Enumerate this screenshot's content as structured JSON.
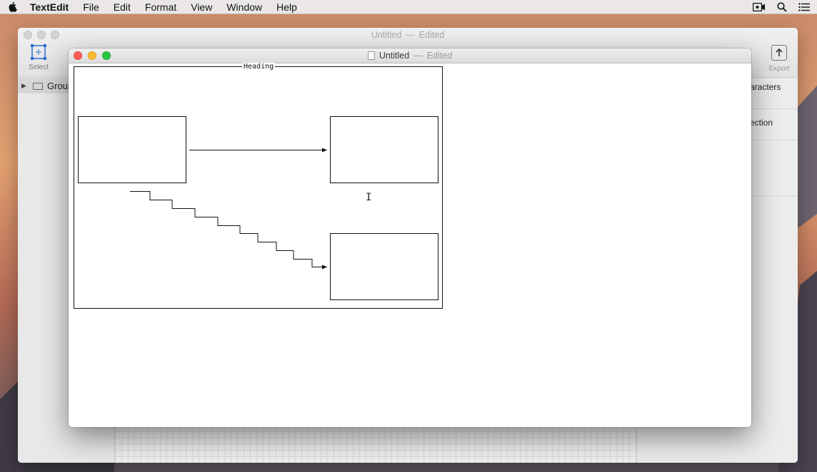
{
  "menubar": {
    "app_name": "TextEdit",
    "items": [
      "File",
      "Edit",
      "Format",
      "View",
      "Window",
      "Help"
    ],
    "icons": [
      "apple-icon",
      "screen-record-icon",
      "spotlight-search-icon",
      "notification-list-icon"
    ]
  },
  "background_window": {
    "title": "Untitled",
    "separator": "—",
    "status": "Edited",
    "select_label": "Select",
    "export_label": "Export",
    "sidebar_group_label": "Group",
    "inspector_rows": [
      "aracters",
      "ection"
    ]
  },
  "textedit_window": {
    "title": "Untitled",
    "separator": "—",
    "status": "Edited",
    "diagram_heading": "Heading"
  },
  "colors": {
    "close": "#fc5f57",
    "minimize": "#fdbc2e",
    "maximize": "#28c840"
  }
}
